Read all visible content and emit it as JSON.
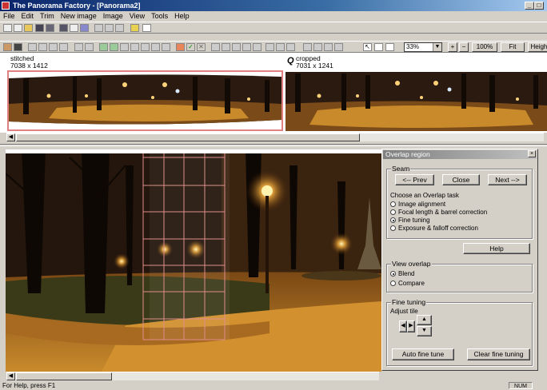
{
  "window": {
    "title": "The Panorama Factory - [Panorama2]",
    "controls": [
      "_",
      "□",
      "×"
    ]
  },
  "menu": [
    "File",
    "Edit",
    "Trim",
    "New image",
    "Image",
    "View",
    "Tools",
    "Help"
  ],
  "toolbar": {
    "zoom_value": "33%",
    "zoom_100": "100%",
    "fit": "Fit",
    "height": "Height",
    "plus": "+",
    "minus": "−"
  },
  "thumbnails": {
    "stitched": {
      "name": "stitched",
      "size": "7038 x 1412"
    },
    "cropped": {
      "name": "cropped",
      "size": "7031 x 1241"
    }
  },
  "dialog": {
    "title": "Overlap region",
    "close": "×",
    "seam": {
      "label": "Seam",
      "prev": "<-- Prev",
      "close": "Close",
      "next": "Next -->",
      "task_prompt": "Choose an Overlap task",
      "tasks": [
        "Image alignment",
        "Focal length & barrel correction",
        "Fine tuning",
        "Exposure & falloff correction"
      ],
      "selected_task": 2
    },
    "help": "Help",
    "view_overlap": {
      "label": "View overlap",
      "options": [
        "Blend",
        "Compare"
      ],
      "selected": 0
    },
    "fine_tuning": {
      "label": "Fine tuning",
      "adjust_tile": "Adjust tile",
      "auto": "Auto fine tune",
      "clear": "Clear fine tuning"
    }
  },
  "status": {
    "hint": "For Help, press F1",
    "num": "NUM"
  },
  "colors": {
    "titlebar": "#0a246a",
    "selection_border": "#e08080",
    "grid_lines": "#e08c8c"
  }
}
